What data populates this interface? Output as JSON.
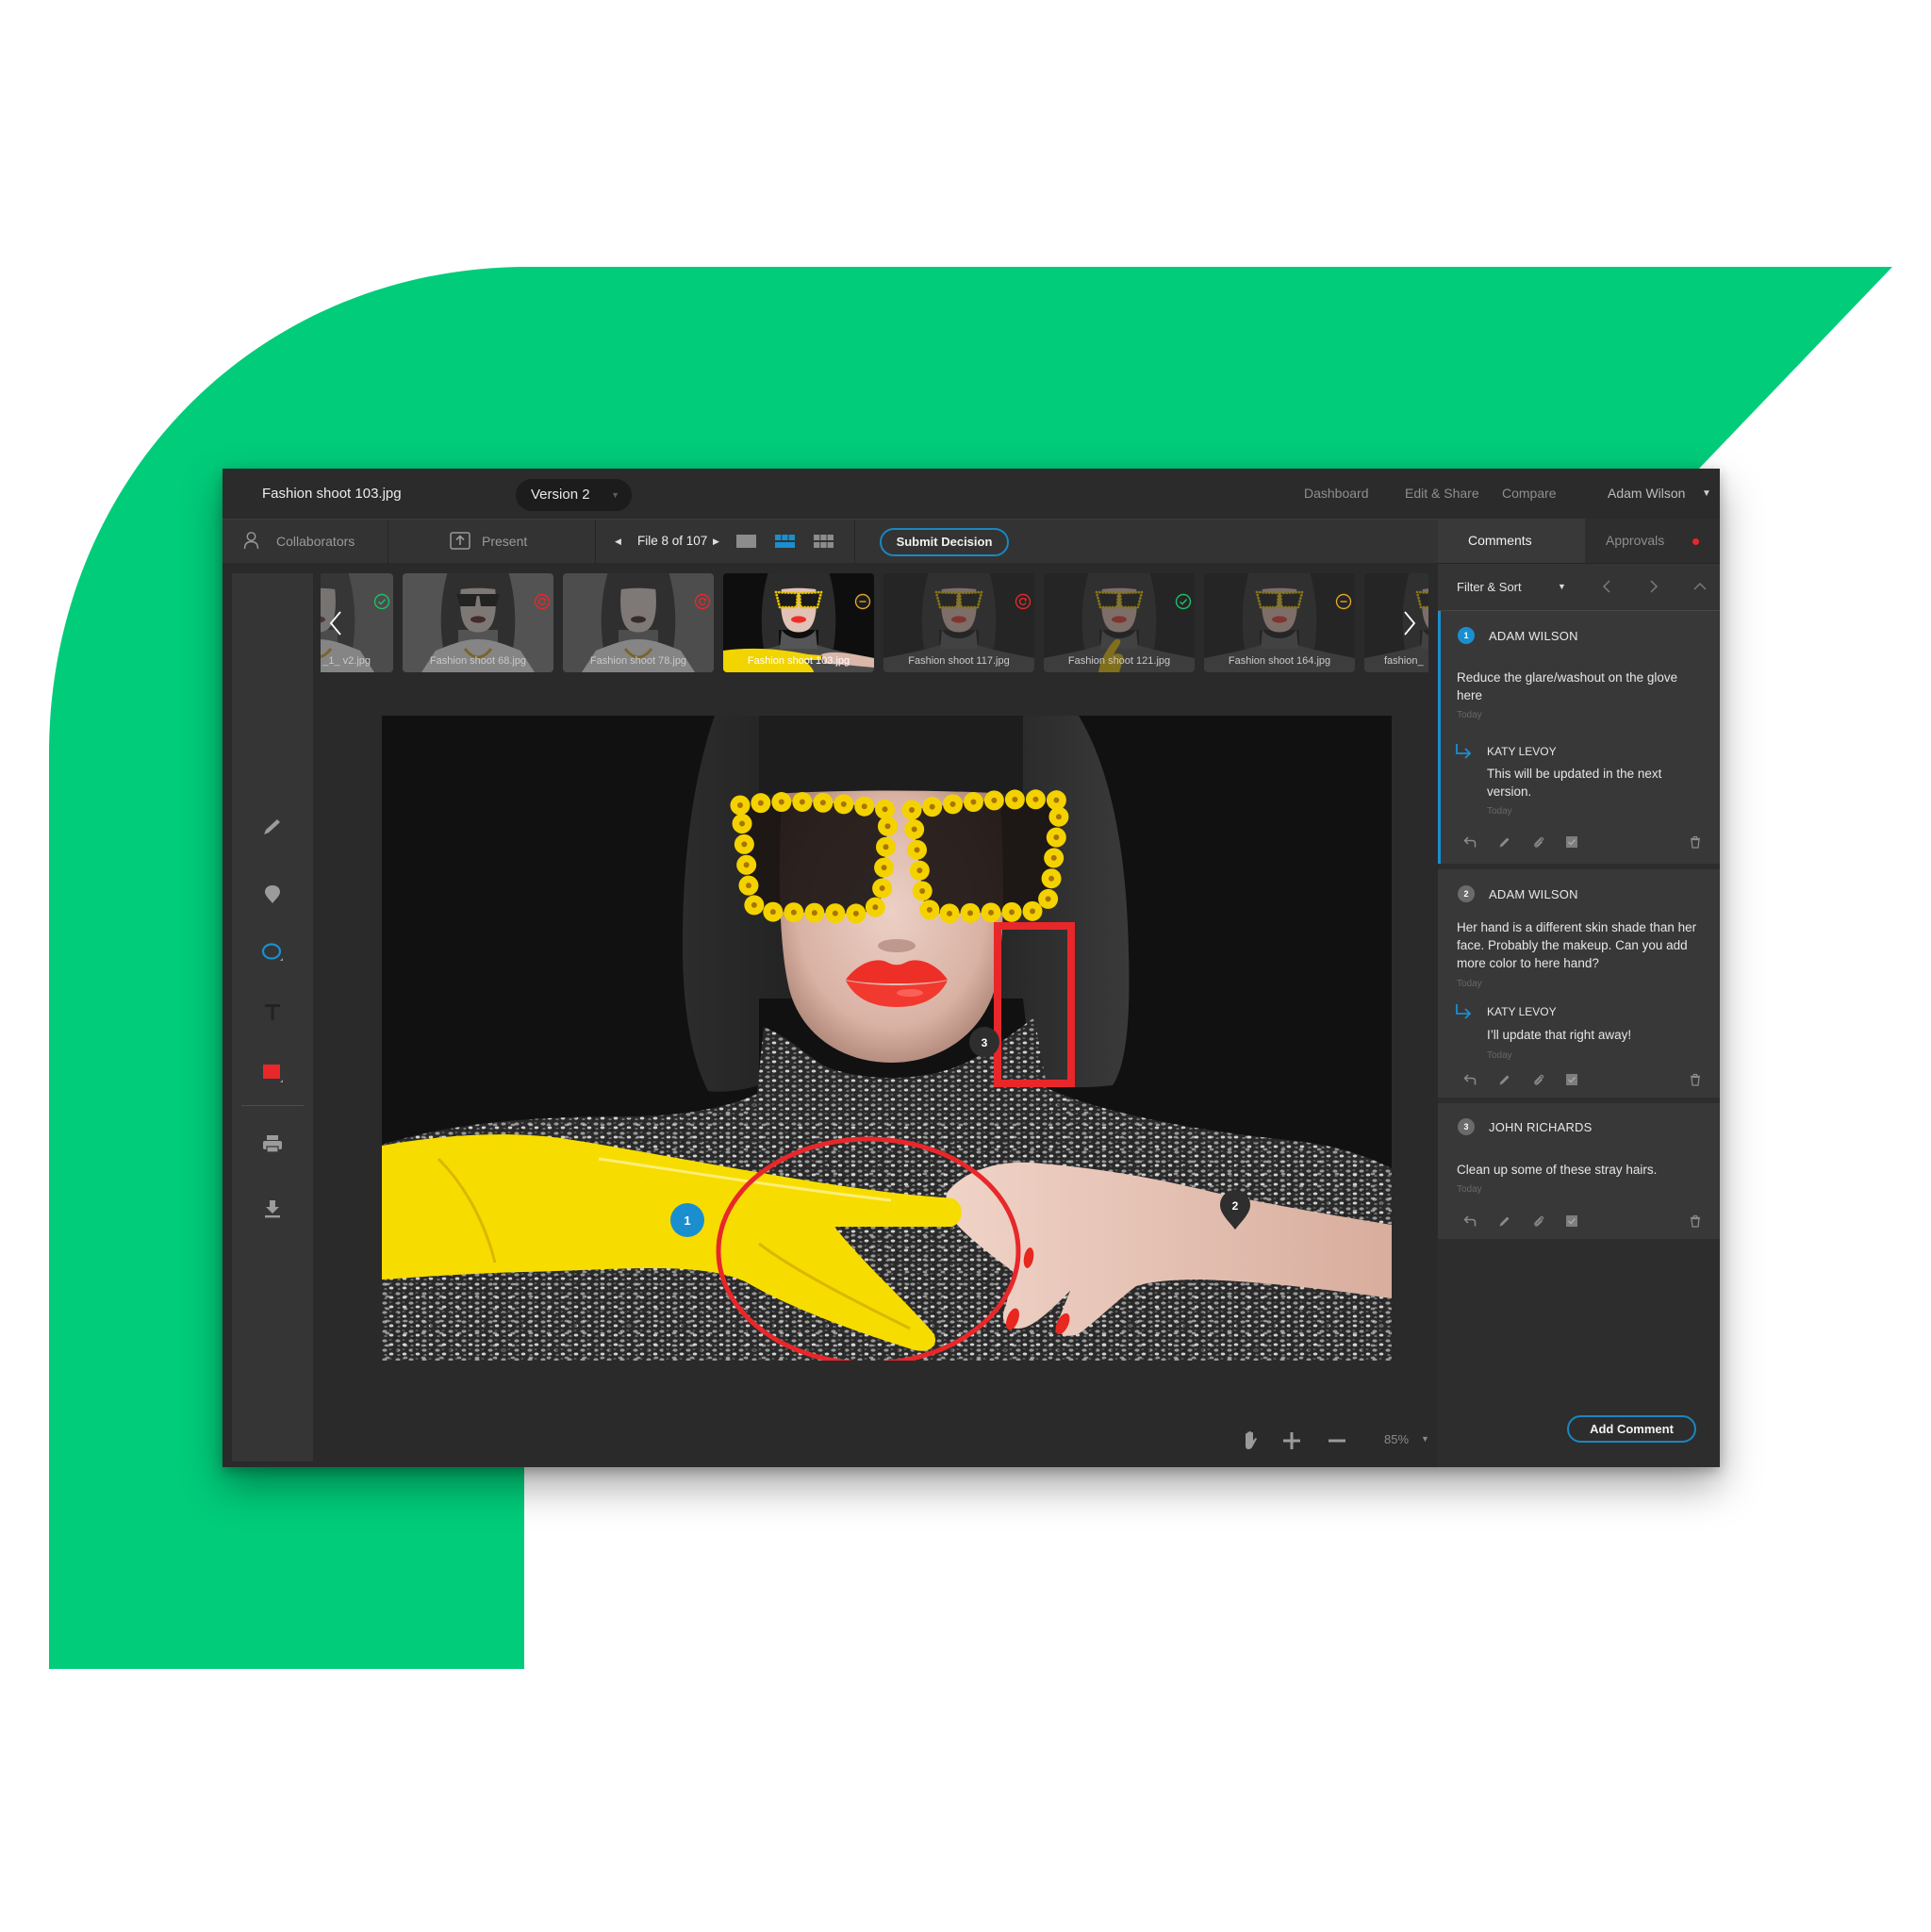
{
  "app": {
    "file_title": "Fashion shoot 103.jpg",
    "version_selector": {
      "label": "Version 2"
    }
  },
  "top_nav": {
    "links": [
      "Dashboard",
      "Edit & Share",
      "Compare"
    ],
    "user_menu": "Adam Wilson"
  },
  "toolbar": {
    "collaborators_label": "Collaborators",
    "present_label": "Present",
    "file_position": "File 8 of 107",
    "view_modes": [
      {
        "name": "single",
        "active": false
      },
      {
        "name": "filmstrip",
        "active": true
      },
      {
        "name": "grid",
        "active": false
      }
    ],
    "submit_decision_label": "Submit Decision"
  },
  "filmstrip": {
    "thumbnails": [
      {
        "label": "_1_ v2.jpg",
        "status": "approved",
        "preview": "gray-portrait"
      },
      {
        "label": "Fashion shoot 68.jpg",
        "status": "changes-requested",
        "preview": "black-sunglasses"
      },
      {
        "label": "Fashion shoot 78.jpg",
        "status": "changes-requested",
        "preview": "bare-portrait"
      },
      {
        "label": "Fashion shoot 103.jpg",
        "status": "pending",
        "preview": "yellow-glasses-glove",
        "selected": true
      },
      {
        "label": "Fashion shoot 117.jpg",
        "status": "changes-requested",
        "preview": "yellow-glasses"
      },
      {
        "label": "Fashion shoot 121.jpg",
        "status": "approved",
        "preview": "yellow-glasses-hand"
      },
      {
        "label": "Fashion shoot 164.jpg",
        "status": "pending",
        "preview": "yellow-glasses"
      },
      {
        "label": "fashion_",
        "status": null,
        "preview": "yellow-glasses"
      }
    ]
  },
  "tools": {
    "items": [
      "pencil",
      "pin",
      "ellipse",
      "text",
      "color",
      "print",
      "download"
    ],
    "active": "ellipse",
    "selected_color": "#e8272a"
  },
  "viewer": {
    "image_subject": "Model with yellow flower sunglasses, red lips and yellow glove",
    "annotations": [
      {
        "number": "1",
        "marker": "circle",
        "shape": "ellipse",
        "marker_color": "#1a8fd0"
      },
      {
        "number": "2",
        "marker": "pin",
        "shape": null,
        "marker_color": "#2e2e2e"
      },
      {
        "number": "3",
        "marker": "circle",
        "shape": "rectangle",
        "marker_color": "#2e2e2e"
      }
    ],
    "zoom_level": "85%"
  },
  "panel": {
    "tabs": [
      {
        "label": "Comments",
        "active": true
      },
      {
        "label": "Approvals",
        "active": false,
        "has_notification": true
      }
    ],
    "filter_label": "Filter & Sort",
    "comments": [
      {
        "number": "1",
        "author": "ADAM WILSON",
        "text": "Reduce the glare/washout on the glove here",
        "time": "Today",
        "reply": {
          "author": "KATY LEVOY",
          "text": "This will be updated in the next version.",
          "time": "Today"
        }
      },
      {
        "number": "2",
        "author": "ADAM WILSON",
        "text": "Her hand is a different skin shade than her face. Probably the makeup. Can you add more color to here hand?",
        "time": "Today",
        "reply": {
          "author": "KATY LEVOY",
          "text": "I’ll update that right away!",
          "time": "Today"
        }
      },
      {
        "number": "3",
        "author": "JOHN RICHARDS",
        "text": "Clean up some of these stray hairs.",
        "time": "Today",
        "reply": null
      }
    ],
    "add_comment_label": "Add Comment"
  },
  "colors": {
    "brand_green": "#00cc7a",
    "accent_blue": "#1a8fd0",
    "annotation_red": "#e8272a",
    "status_approved": "#1fbf6a",
    "status_changes_requested": "#e8272a",
    "status_pending": "#e0a526"
  }
}
